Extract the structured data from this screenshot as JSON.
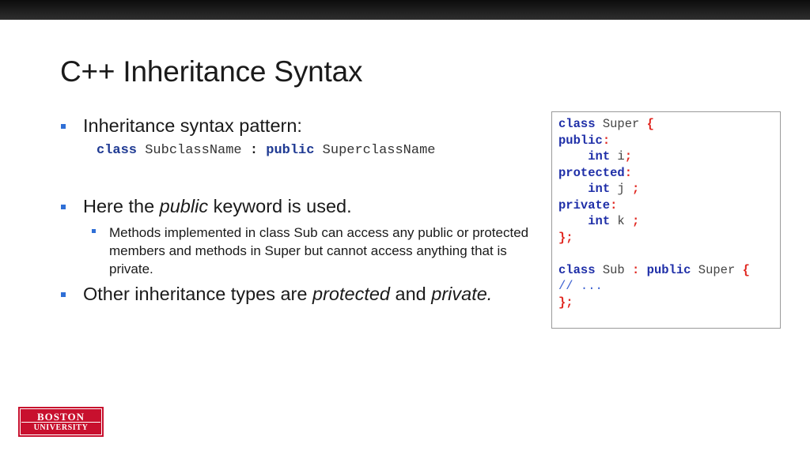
{
  "slide": {
    "title": "C++ Inheritance Syntax"
  },
  "bullets": [
    {
      "text": "Inheritance syntax pattern:",
      "syntax": {
        "kw1": "class",
        "name1": " SubclassName ",
        "colon": ":",
        "kw2": " public",
        "name2": " SuperclassName"
      }
    },
    {
      "pre": "Here the ",
      "em": "public",
      "post": " keyword is used.",
      "sub": "Methods implemented in class Sub can access any public or protected members and methods in Super but cannot access anything that is private."
    },
    {
      "pre": "Other inheritance types are ",
      "em1": "protected",
      "mid": " and ",
      "em2": "private."
    }
  ],
  "code": {
    "l1_kw": "class",
    "l1_id": " Super ",
    "l1_brace": "{",
    "l2_kw": "public",
    "l2_colon": ":",
    "l3_indent": "    ",
    "l3_kw": "int",
    "l3_id": " i",
    "l3_semi": ";",
    "l4_kw": "protected",
    "l4_colon": ":",
    "l5_indent": "    ",
    "l5_kw": "int",
    "l5_id": " j ",
    "l5_semi": ";",
    "l6_kw": "private",
    "l6_colon": ":",
    "l7_indent": "    ",
    "l7_kw": "int",
    "l7_id": " k ",
    "l7_semi": ";",
    "l8_end": "};",
    "l10_kw": "class",
    "l10_id": " Sub ",
    "l10_colon": ":",
    "l10_kw2": " public",
    "l10_id2": " Super ",
    "l10_brace": "{",
    "l11_comment": "// ...",
    "l12_end": "};"
  },
  "logo": {
    "line1": "BOSTON",
    "line2": "UNIVERSITY"
  },
  "colors": {
    "bullet": "#2f6fd6",
    "keyword": "#1f2fa8",
    "punctuation": "#e0261f",
    "logo": "#c8102e"
  }
}
